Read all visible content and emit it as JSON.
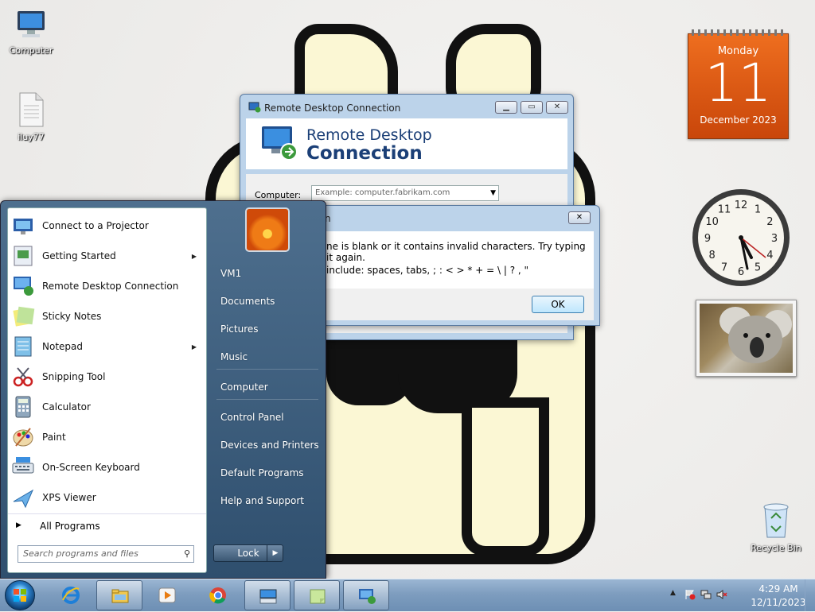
{
  "desktop": {
    "icons": [
      {
        "label": "Computer"
      },
      {
        "label": "iluy77"
      },
      {
        "label": "Recycle Bin"
      }
    ]
  },
  "gadgets": {
    "calendar": {
      "weekday": "Monday",
      "day": "11",
      "month_year": "December 2023"
    },
    "clock": {
      "numerals": [
        "12",
        "1",
        "2",
        "3",
        "4",
        "5",
        "6",
        "7",
        "8",
        "9",
        "10",
        "11"
      ]
    }
  },
  "rdc_window": {
    "title": "Remote Desktop Connection",
    "banner_line1": "Remote Desktop",
    "banner_line2": "Connection",
    "computer_label": "Computer:",
    "computer_placeholder": "Example: computer.fabrikam.com"
  },
  "error_dialog": {
    "title_fragment": "n",
    "message_line1": "ne is blank or it contains invalid characters. Try typing it again.",
    "message_line2": "include: spaces, tabs, ; : < > * + = \\ | ? , \"",
    "ok_label": "OK"
  },
  "start_menu": {
    "programs": [
      {
        "label": "Connect to a Projector",
        "icon": "projector-icon",
        "submenu": false
      },
      {
        "label": "Getting Started",
        "icon": "getting-started-icon",
        "submenu": true
      },
      {
        "label": "Remote Desktop Connection",
        "icon": "remote-desktop-icon",
        "submenu": false
      },
      {
        "label": "Sticky Notes",
        "icon": "sticky-notes-icon",
        "submenu": false
      },
      {
        "label": "Notepad",
        "icon": "notepad-icon",
        "submenu": true
      },
      {
        "label": "Snipping Tool",
        "icon": "scissors-icon",
        "submenu": false
      },
      {
        "label": "Calculator",
        "icon": "calculator-icon",
        "submenu": false
      },
      {
        "label": "Paint",
        "icon": "paint-palette-icon",
        "submenu": false
      },
      {
        "label": "On-Screen Keyboard",
        "icon": "keyboard-icon",
        "submenu": false
      },
      {
        "label": "XPS Viewer",
        "icon": "xps-viewer-icon",
        "submenu": false
      }
    ],
    "all_programs": "All Programs",
    "search_placeholder": "Search programs and files",
    "places": [
      "VM1",
      "Documents",
      "Pictures",
      "Music",
      "Computer",
      "Control Panel",
      "Devices and Printers",
      "Default Programs",
      "Help and Support"
    ],
    "lock_label": "Lock"
  },
  "taskbar": {
    "pinned": [
      "internet-explorer-icon",
      "windows-explorer-icon",
      "media-player-icon",
      "chrome-icon",
      "on-screen-keyboard-icon",
      "sticky-notes-icon",
      "remote-desktop-icon"
    ],
    "time": "4:29 AM",
    "date": "12/11/2023"
  }
}
